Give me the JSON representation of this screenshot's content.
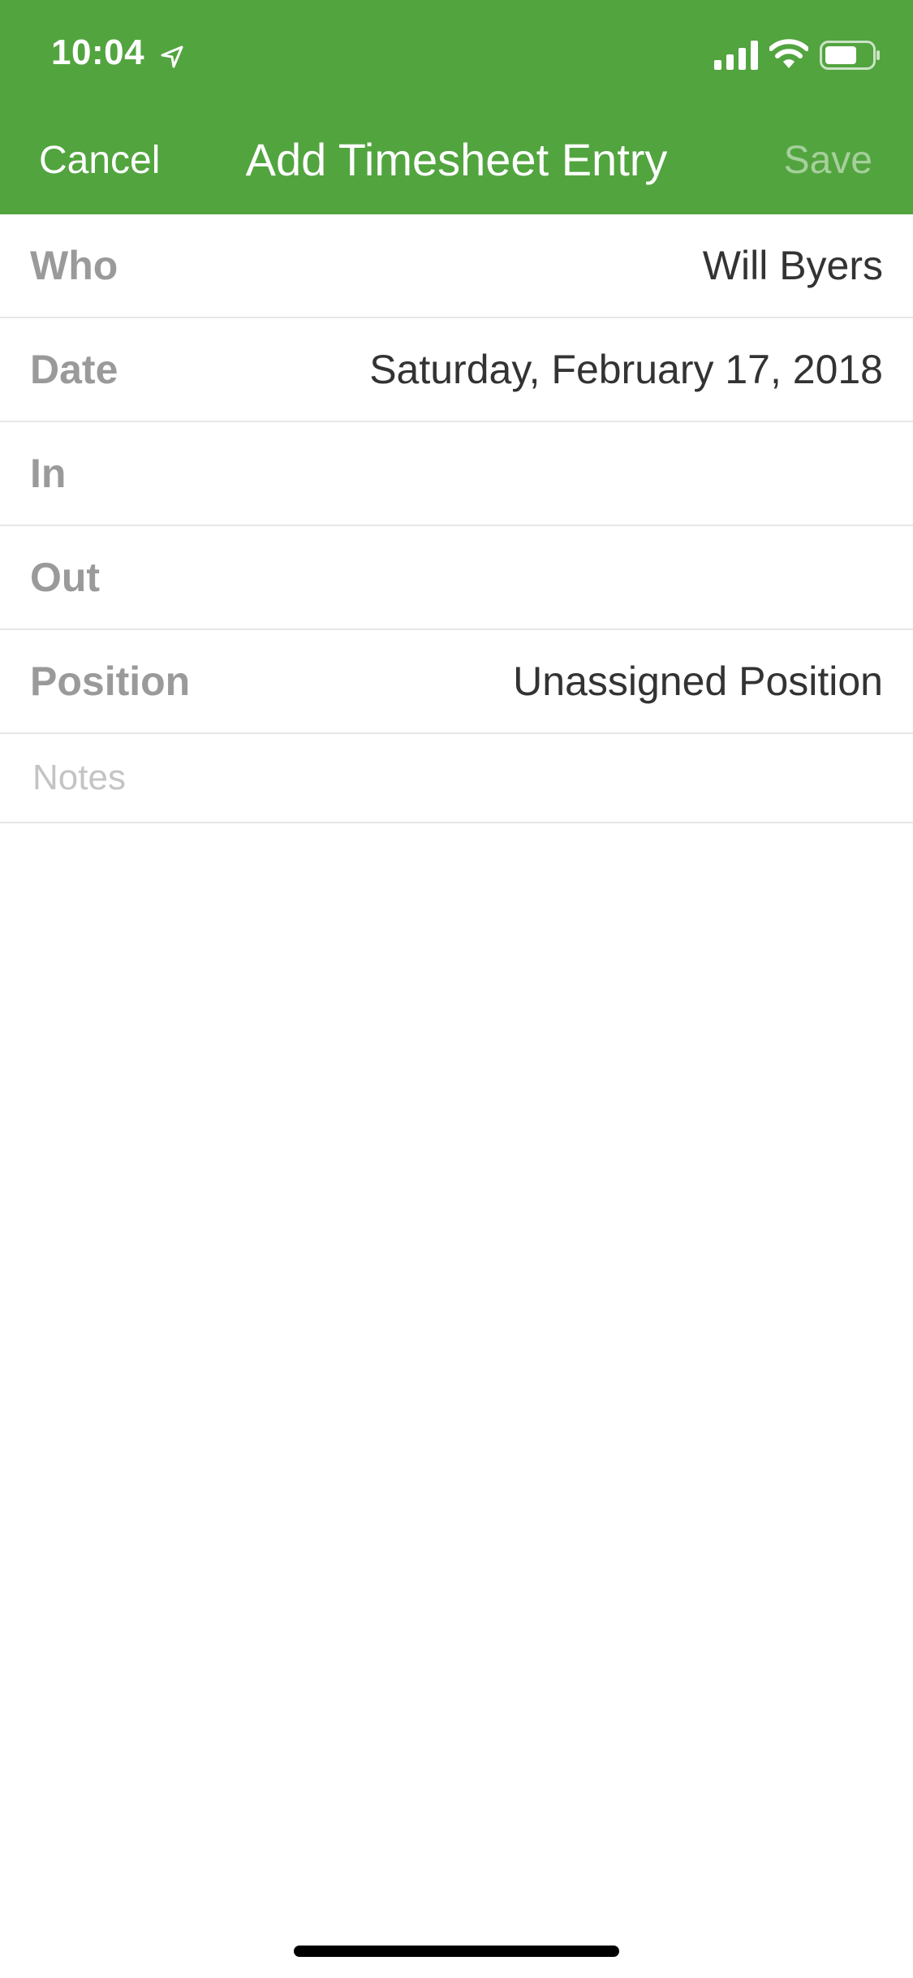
{
  "status_bar": {
    "time": "10:04"
  },
  "nav": {
    "cancel_label": "Cancel",
    "title": "Add Timesheet Entry",
    "save_label": "Save"
  },
  "form": {
    "who": {
      "label": "Who",
      "value": "Will Byers"
    },
    "date": {
      "label": "Date",
      "value": "Saturday, February 17, 2018"
    },
    "in": {
      "label": "In",
      "value": ""
    },
    "out": {
      "label": "Out",
      "value": ""
    },
    "position": {
      "label": "Position",
      "value": "Unassigned Position"
    },
    "notes": {
      "placeholder": "Notes",
      "value": ""
    }
  },
  "colors": {
    "header_bg": "#52a43f",
    "save_disabled": "#a6d09b",
    "label": "#9a9a9a",
    "value": "#333333"
  },
  "icons": [
    "location-arrow-icon",
    "signal-icon",
    "wifi-icon",
    "battery-icon"
  ]
}
